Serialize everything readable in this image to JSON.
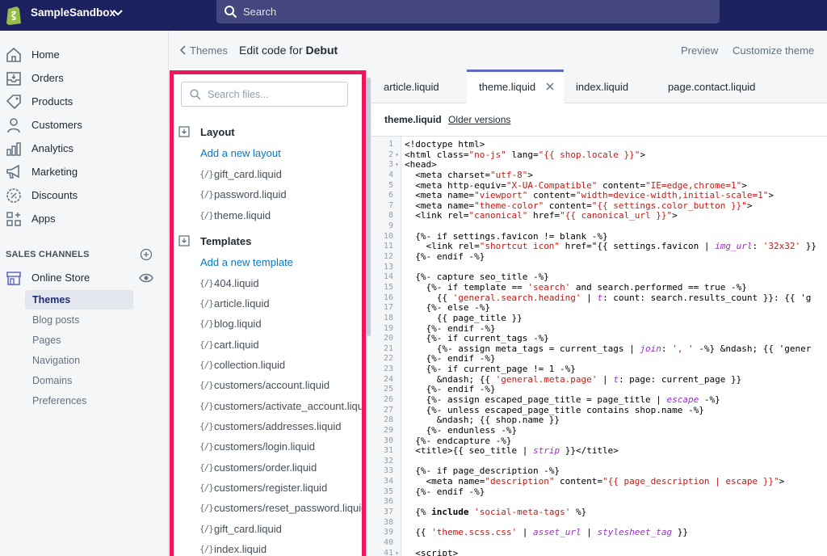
{
  "topbar": {
    "store_name": "SampleSandbox",
    "search_placeholder": "Search"
  },
  "sidebar": {
    "items": [
      {
        "label": "Home",
        "icon": "home-icon"
      },
      {
        "label": "Orders",
        "icon": "orders-icon"
      },
      {
        "label": "Products",
        "icon": "tag-icon"
      },
      {
        "label": "Customers",
        "icon": "person-icon"
      },
      {
        "label": "Analytics",
        "icon": "bar-chart-icon"
      },
      {
        "label": "Marketing",
        "icon": "megaphone-icon"
      },
      {
        "label": "Discounts",
        "icon": "discount-icon"
      },
      {
        "label": "Apps",
        "icon": "apps-icon"
      }
    ],
    "channels_heading": "SALES CHANNELS",
    "online_store": "Online Store",
    "sub_items": [
      {
        "label": "Themes",
        "active": true
      },
      {
        "label": "Blog posts"
      },
      {
        "label": "Pages"
      },
      {
        "label": "Navigation"
      },
      {
        "label": "Domains"
      },
      {
        "label": "Preferences"
      }
    ]
  },
  "header": {
    "back_label": "Themes",
    "title_prefix": "Edit code for",
    "theme_name": "Debut",
    "preview": "Preview",
    "customize": "Customize theme"
  },
  "files": {
    "search_placeholder": "Search files...",
    "layout_heading": "Layout",
    "add_layout": "Add a new layout",
    "layout_files": [
      "gift_card.liquid",
      "password.liquid",
      "theme.liquid"
    ],
    "templates_heading": "Templates",
    "add_template": "Add a new template",
    "template_files": [
      "404.liquid",
      "article.liquid",
      "blog.liquid",
      "cart.liquid",
      "collection.liquid",
      "customers/account.liquid",
      "customers/activate_account.liquid",
      "customers/addresses.liquid",
      "customers/login.liquid",
      "customers/order.liquid",
      "customers/register.liquid",
      "customers/reset_password.liquid",
      "gift_card.liquid",
      "index.liquid"
    ],
    "liquid_icon": "{/}"
  },
  "tabs": [
    {
      "label": "article.liquid"
    },
    {
      "label": "theme.liquid",
      "active": true
    },
    {
      "label": "index.liquid"
    },
    {
      "label": "page.contact.liquid"
    }
  ],
  "editor": {
    "file_name": "theme.liquid",
    "older_versions": "Older versions",
    "lines": [
      {
        "n": "1",
        "t": "<!doctype html>"
      },
      {
        "n": "2",
        "fold": true,
        "t": "<html class=\"no-js\" lang=\"{{ shop.locale }}\">"
      },
      {
        "n": "3",
        "fold": true,
        "t": "<head>"
      },
      {
        "n": "4",
        "t": "  <meta charset=\"utf-8\">"
      },
      {
        "n": "5",
        "t": "  <meta http-equiv=\"X-UA-Compatible\" content=\"IE=edge,chrome=1\">"
      },
      {
        "n": "6",
        "t": "  <meta name=\"viewport\" content=\"width=device-width,initial-scale=1\">"
      },
      {
        "n": "7",
        "t": "  <meta name=\"theme-color\" content=\"{{ settings.color_button }}\">"
      },
      {
        "n": "8",
        "t": "  <link rel=\"canonical\" href=\"{{ canonical_url }}\">"
      },
      {
        "n": "9",
        "t": ""
      },
      {
        "n": "10",
        "t": "  {%- if settings.favicon != blank -%}"
      },
      {
        "n": "11",
        "t": "    <link rel=\"shortcut icon\" href=\"{{ settings.favicon | img_url: '32x32' }}"
      },
      {
        "n": "12",
        "t": "  {%- endif -%}"
      },
      {
        "n": "13",
        "t": ""
      },
      {
        "n": "14",
        "t": "  {%- capture seo_title -%}"
      },
      {
        "n": "15",
        "t": "    {%- if template == 'search' and search.performed == true -%}"
      },
      {
        "n": "16",
        "t": "      {{ 'general.search.heading' | t: count: search.results_count }}: {{ 'g"
      },
      {
        "n": "17",
        "t": "    {%- else -%}"
      },
      {
        "n": "18",
        "t": "      {{ page_title }}"
      },
      {
        "n": "19",
        "t": "    {%- endif -%}"
      },
      {
        "n": "20",
        "t": "    {%- if current_tags -%}"
      },
      {
        "n": "21",
        "t": "      {%- assign meta_tags = current_tags | join: ', ' -%} &ndash; {{ 'gener"
      },
      {
        "n": "22",
        "t": "    {%- endif -%}"
      },
      {
        "n": "23",
        "t": "    {%- if current_page != 1 -%}"
      },
      {
        "n": "24",
        "t": "      &ndash; {{ 'general.meta.page' | t: page: current_page }}"
      },
      {
        "n": "25",
        "t": "    {%- endif -%}"
      },
      {
        "n": "26",
        "t": "    {%- assign escaped_page_title = page_title | escape -%}"
      },
      {
        "n": "27",
        "t": "    {%- unless escaped_page_title contains shop.name -%}"
      },
      {
        "n": "28",
        "t": "      &ndash; {{ shop.name }}"
      },
      {
        "n": "29",
        "t": "    {%- endunless -%}"
      },
      {
        "n": "30",
        "t": "  {%- endcapture -%}"
      },
      {
        "n": "31",
        "t": "  <title>{{ seo_title | strip }}</title>"
      },
      {
        "n": "32",
        "t": ""
      },
      {
        "n": "33",
        "t": "  {%- if page_description -%}"
      },
      {
        "n": "34",
        "t": "    <meta name=\"description\" content=\"{{ page_description | escape }}\">"
      },
      {
        "n": "35",
        "t": "  {%- endif -%}"
      },
      {
        "n": "36",
        "t": ""
      },
      {
        "n": "37",
        "t": "  {% include 'social-meta-tags' %}"
      },
      {
        "n": "38",
        "t": ""
      },
      {
        "n": "39",
        "t": "  {{ 'theme.scss.css' | asset_url | stylesheet_tag }}"
      },
      {
        "n": "40",
        "t": ""
      },
      {
        "n": "41",
        "fold": true,
        "t": "  <script>"
      }
    ]
  },
  "colors": {
    "topbar": "#1c2260",
    "accent": "#5c6ac4",
    "highlight": "#f0145a",
    "link": "#007ace"
  }
}
